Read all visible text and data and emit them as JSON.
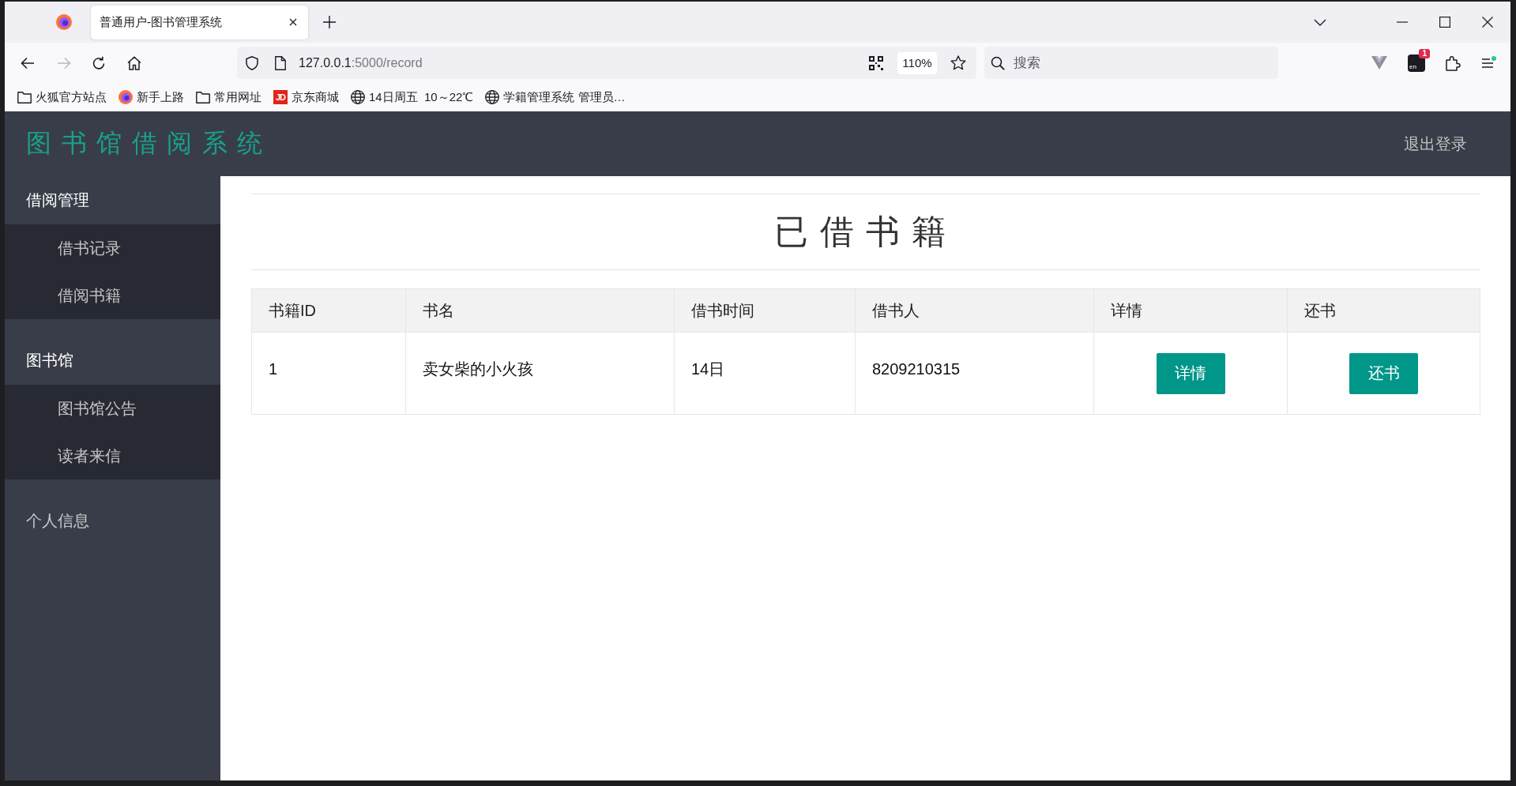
{
  "browser": {
    "tabs": [
      {
        "title": "普通用户-图书管理系统",
        "selected": true
      }
    ],
    "forward_button": {
      "disabled": true
    },
    "address": {
      "host": "127.0.0.1",
      "path": ":5000/record"
    },
    "zoom": "110%",
    "search": {
      "placeholder": "搜索"
    },
    "extension": {
      "label": "en",
      "badge": "1"
    },
    "bookmarks": [
      {
        "kind": "folder",
        "label": "火狐官方站点"
      },
      {
        "kind": "firefox",
        "label": "新手上路"
      },
      {
        "kind": "folder",
        "label": "常用网址"
      },
      {
        "kind": "letters",
        "logo": "JD",
        "label": "京东商城"
      },
      {
        "kind": "globe",
        "label": "14日周五  10～22℃"
      },
      {
        "kind": "globe",
        "label": "学籍管理系统 管理员…"
      }
    ]
  },
  "app": {
    "title": "图书馆借阅系统",
    "logout": "退出登录",
    "sidebar": [
      {
        "label": "借阅管理",
        "expanded": true,
        "selected": false,
        "children": [
          {
            "label": "借书记录",
            "selected": false
          },
          {
            "label": "借阅书籍",
            "selected": false
          }
        ]
      },
      {
        "label": "图书馆",
        "expanded": true,
        "selected": false,
        "children": [
          {
            "label": "图书馆公告",
            "selected": false
          },
          {
            "label": "读者来信",
            "selected": false
          }
        ]
      },
      {
        "label": "个人信息",
        "expanded": false,
        "selected": false
      }
    ],
    "page_title": "已借书籍",
    "table": {
      "columns": [
        "书籍ID",
        "书名",
        "借书时间",
        "借书人",
        "详情",
        "还书"
      ],
      "rows": [
        {
          "cells": [
            {
              "kind": "text",
              "text": "1"
            },
            {
              "kind": "text",
              "text": "卖女柴的小火孩"
            },
            {
              "kind": "text",
              "text": "14日"
            },
            {
              "kind": "text",
              "text": "8209210315"
            },
            {
              "kind": "button",
              "text": "详情"
            },
            {
              "kind": "button",
              "text": "还书"
            }
          ]
        }
      ]
    }
  }
}
